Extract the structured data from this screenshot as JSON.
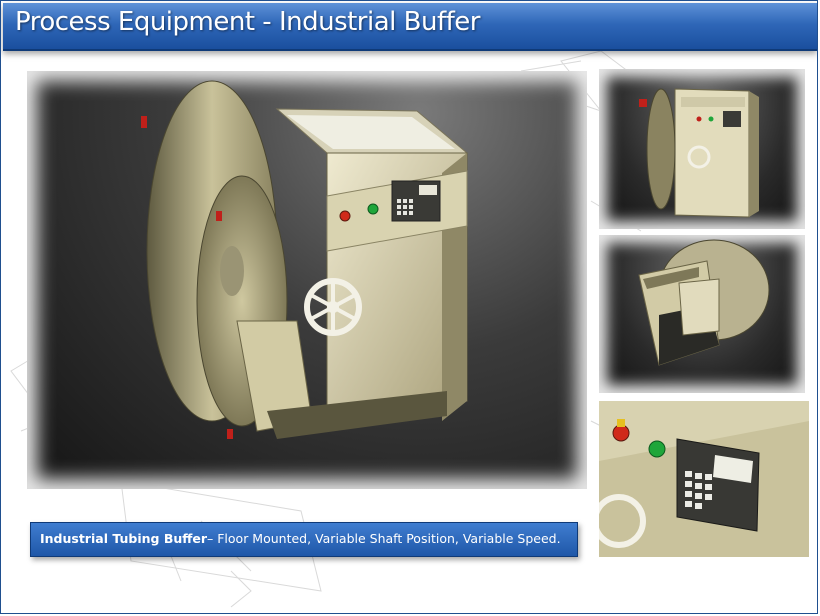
{
  "header": {
    "title": "Process Equipment - Industrial Buffer"
  },
  "caption": {
    "bold": "Industrial Tubing Buffer",
    "text": "– Floor Mounted, Variable Shaft Position, Variable Speed."
  },
  "colors": {
    "title_bar": "#2f67b8",
    "caption_bar": "#2b68bb",
    "machine_body": "#d8d2a8"
  }
}
